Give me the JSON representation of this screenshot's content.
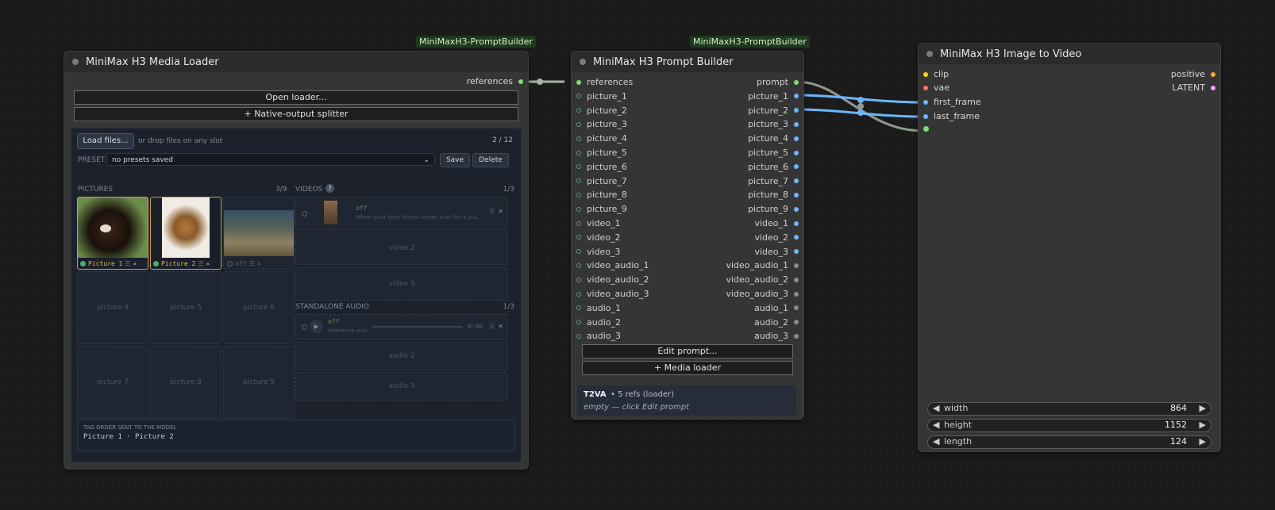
{
  "media_loader": {
    "badge": "MiniMaxH3-PromptBuilder",
    "title": "MiniMax H3 Media Loader",
    "output_label": "references",
    "open_loader": "Open loader...",
    "splitter": "+ Native-output splitter",
    "load_files": "Load files...",
    "drop_hint": "or drop files on any slot",
    "file_count": "2 / 12",
    "preset_label": "PRESET",
    "preset_value": "no presets saved",
    "save": "Save",
    "delete": "Delete",
    "pictures_label": "PICTURES",
    "pictures_count": "3/9",
    "videos_label": "VIDEOS",
    "videos_count": "1/3",
    "picture1_tag": "Picture 1",
    "picture2_tag": "Picture 2",
    "picture3_tag": "off",
    "empty_pictures": [
      "picture 4",
      "picture 5",
      "picture 6",
      "picture 7",
      "picture 8",
      "picture 9"
    ],
    "video1_state": "off",
    "video1_caption": "When your best friend comes over for a pla...",
    "video2": "video 2",
    "video3": "video 3",
    "audio_label": "STANDALONE AUDIO",
    "audio_count": "1/3",
    "audio1_state": "off",
    "audio1_caption": "reference.wav",
    "audio1_time": "0:00",
    "audio2": "audio 2",
    "audio3": "audio 3",
    "tag_order_label": "TAG ORDER SENT TO THE MODEL",
    "tag_order_value": "Picture 1 · Picture 2"
  },
  "prompt_builder": {
    "badge": "MiniMaxH3-PromptBuilder",
    "title": "MiniMax H3 Prompt Builder",
    "inputs": [
      "references",
      "picture_1",
      "picture_2",
      "picture_3",
      "picture_4",
      "picture_5",
      "picture_6",
      "picture_7",
      "picture_8",
      "picture_9",
      "video_1",
      "video_2",
      "video_3",
      "video_audio_1",
      "video_audio_2",
      "video_audio_3",
      "audio_1",
      "audio_2",
      "audio_3"
    ],
    "outputs": [
      "prompt",
      "picture_1",
      "picture_2",
      "picture_3",
      "picture_4",
      "picture_5",
      "picture_6",
      "picture_7",
      "picture_8",
      "picture_9",
      "video_1",
      "video_2",
      "video_3",
      "video_audio_1",
      "video_audio_2",
      "video_audio_3",
      "audio_1",
      "audio_2",
      "audio_3"
    ],
    "edit_prompt": "Edit prompt...",
    "media_loader": "+ Media loader",
    "mode": "T2VA",
    "refs": "• 5 refs (loader)",
    "empty_hint": "empty — click Edit prompt"
  },
  "image_to_video": {
    "title": "MiniMax H3 Image to Video",
    "inputs": [
      "clip",
      "vae",
      "first_frame",
      "last_frame"
    ],
    "outputs": [
      "positive",
      "LATENT"
    ],
    "width_label": "width",
    "width_value": "864",
    "height_label": "height",
    "height_value": "1152",
    "length_label": "length",
    "length_value": "124"
  },
  "colors": {
    "image": "#6ab7ff",
    "green": "#7be07b",
    "grey": "#8a8a8a",
    "clip": "#ffd500",
    "vae": "#ff6e6e",
    "latent": "#ff9cf9",
    "positive": "#ffa931"
  }
}
